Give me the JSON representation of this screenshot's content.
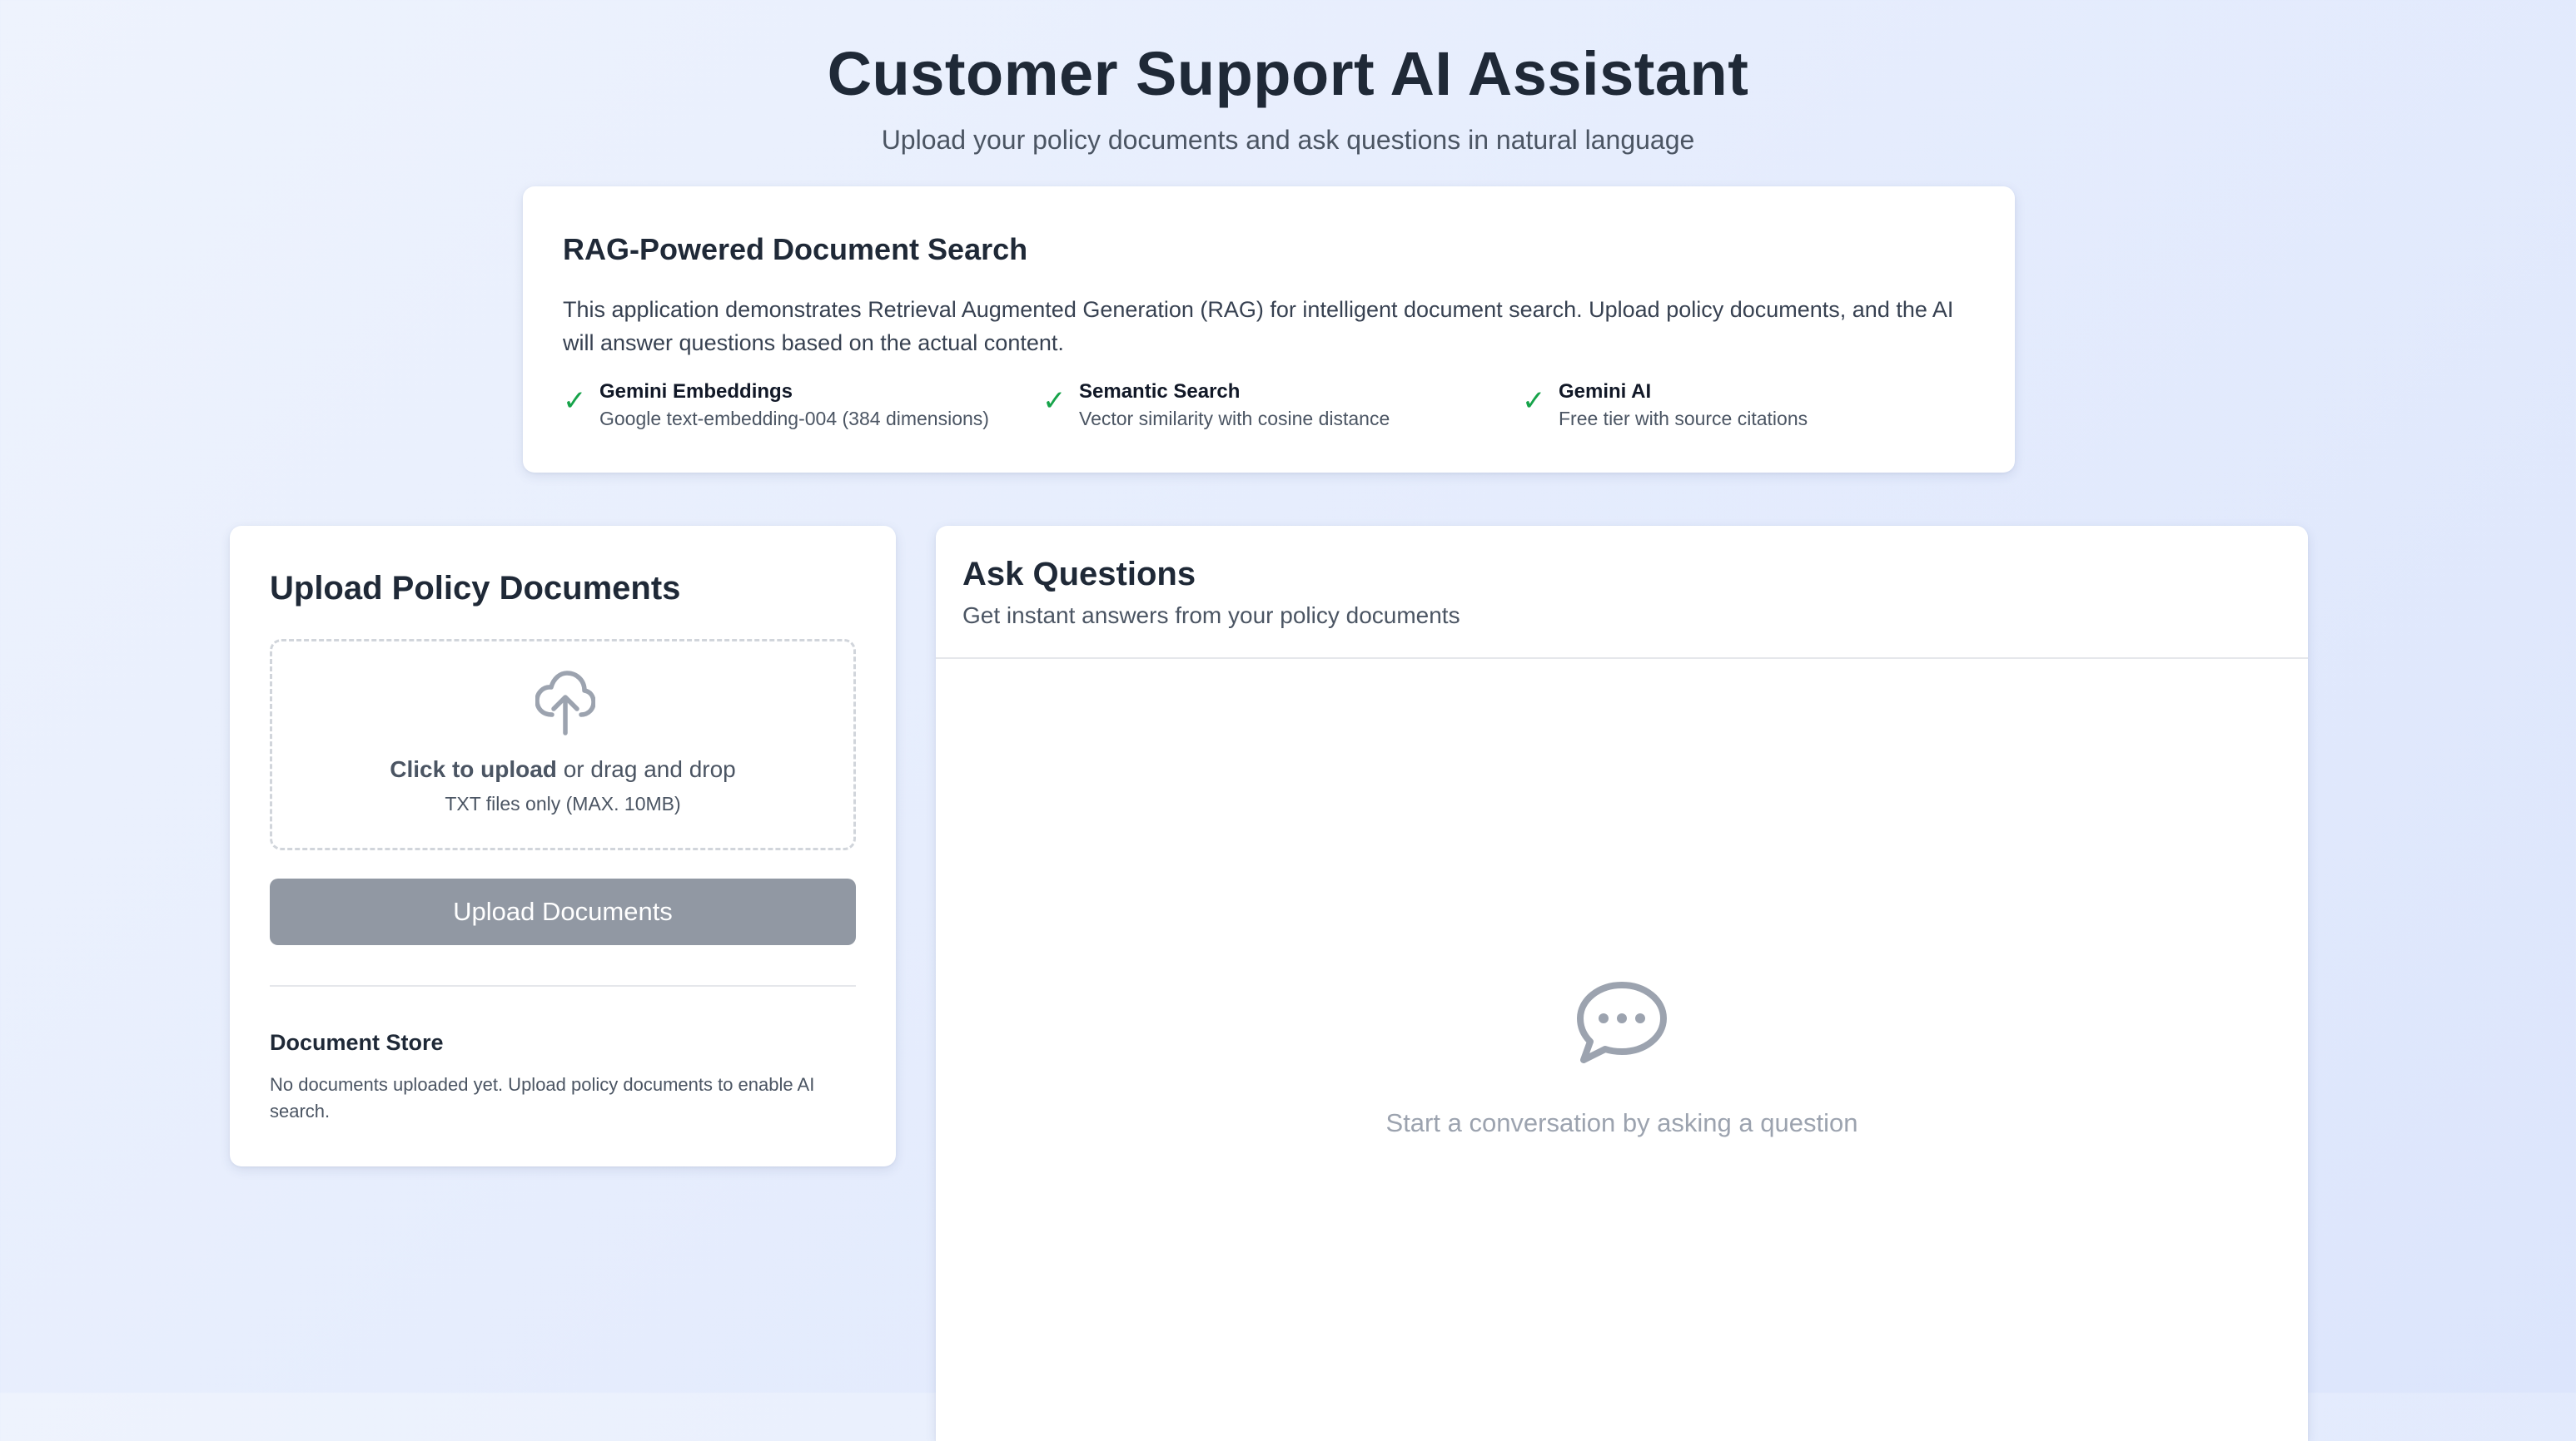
{
  "header": {
    "title": "Customer Support AI Assistant",
    "subtitle": "Upload your policy documents and ask questions in natural language"
  },
  "info": {
    "title": "RAG-Powered Document Search",
    "description": "This application demonstrates Retrieval Augmented Generation (RAG) for intelligent document search. Upload policy documents, and the AI will answer questions based on the actual content.",
    "features": [
      {
        "icon": "check-icon",
        "title": "Gemini Embeddings",
        "description": "Google text-embedding-004 (384 dimensions)"
      },
      {
        "icon": "check-icon",
        "title": "Semantic Search",
        "description": "Vector similarity with cosine distance"
      },
      {
        "icon": "check-icon",
        "title": "Gemini AI",
        "description": "Free tier with source citations"
      }
    ],
    "check_symbol": "✓"
  },
  "upload": {
    "title": "Upload Policy Documents",
    "dropzone": {
      "icon": "cloud-upload-icon",
      "click_text": "Click to upload",
      "drag_text": "or drag and drop",
      "hint": "TXT files only (MAX. 10MB)"
    },
    "button_label": "Upload Documents",
    "store_title": "Document Store",
    "store_empty": "No documents uploaded yet. Upload policy documents to enable AI search."
  },
  "chat": {
    "title": "Ask Questions",
    "subtitle": "Get instant answers from your policy documents",
    "empty_icon": "chat-bubble-icon",
    "empty_text": "Start a conversation by asking a question"
  },
  "colors": {
    "accent_check": "#16a34a",
    "button_disabled": "#9198a3",
    "icon_gray": "#9ca3af"
  }
}
